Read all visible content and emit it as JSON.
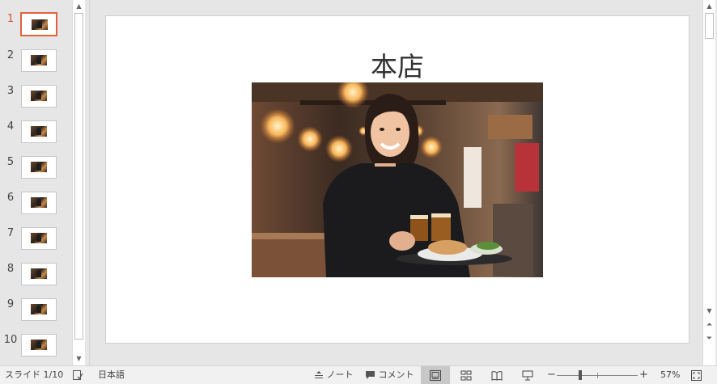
{
  "thumbnails": [
    {
      "number": "1",
      "selected": true
    },
    {
      "number": "2"
    },
    {
      "number": "3"
    },
    {
      "number": "4"
    },
    {
      "number": "5"
    },
    {
      "number": "6"
    },
    {
      "number": "7"
    },
    {
      "number": "8"
    },
    {
      "number": "9"
    },
    {
      "number": "10"
    }
  ],
  "slide": {
    "title": "本店",
    "photo_icon": "restaurant-staff-photo"
  },
  "status": {
    "slide_indicator": "スライド 1/10",
    "language": "日本語",
    "notes_label": "ノート",
    "comments_label": "コメント",
    "zoom_minus": "−",
    "zoom_plus": "+",
    "zoom_level": "57%",
    "zoom_fraction": 0.57
  },
  "colors": {
    "accent": "#e0623e",
    "selected_number": "#d35230"
  }
}
